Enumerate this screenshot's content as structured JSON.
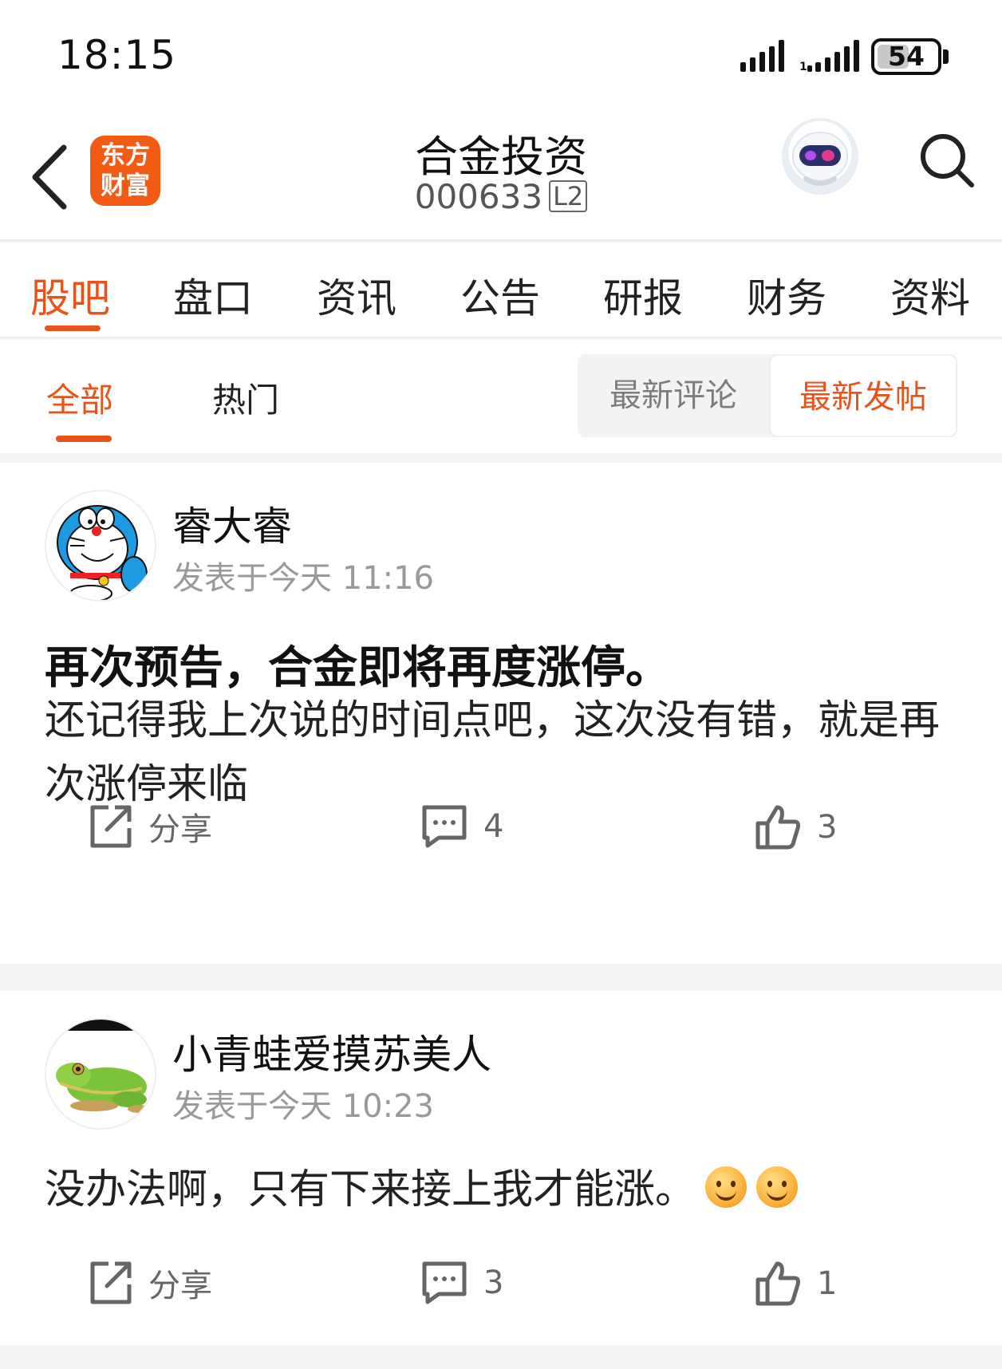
{
  "status_bar": {
    "time": "18:15",
    "battery": "54",
    "battery_level": 0.54
  },
  "header": {
    "logo_line1": "东方",
    "logo_line2": "财富",
    "title": "合金投资",
    "code": "000633",
    "level_badge": "L2",
    "icons": {
      "back": "chevron-left-icon",
      "avatar": "robot-avatar",
      "search": "search-icon"
    }
  },
  "main_tabs": [
    "股吧",
    "盘口",
    "资讯",
    "公告",
    "研报",
    "财务",
    "资料"
  ],
  "active_main_tab": "股吧",
  "sub_tabs": [
    "全部",
    "热门"
  ],
  "active_sub_tab": "全部",
  "sort_options": [
    "最新评论",
    "最新发帖"
  ],
  "active_sort": "最新发帖",
  "accent_color": "#e8531a",
  "posts": [
    {
      "author": "睿大睿",
      "time": "发表于今天 11:16",
      "title": "再次预告，合金即将再度涨停。",
      "body": "还记得我上次说的时间点吧，这次没有错，就是再次涨停来临",
      "share_label": "分享",
      "comments": "4",
      "likes": "3"
    },
    {
      "author": "小青蛙爱摸苏美人",
      "time": "发表于今天 10:23",
      "body": "没办法啊，只有下来接上我才能涨。",
      "emoji_count": 2,
      "share_label": "分享",
      "comments": "3",
      "likes": "1"
    }
  ]
}
